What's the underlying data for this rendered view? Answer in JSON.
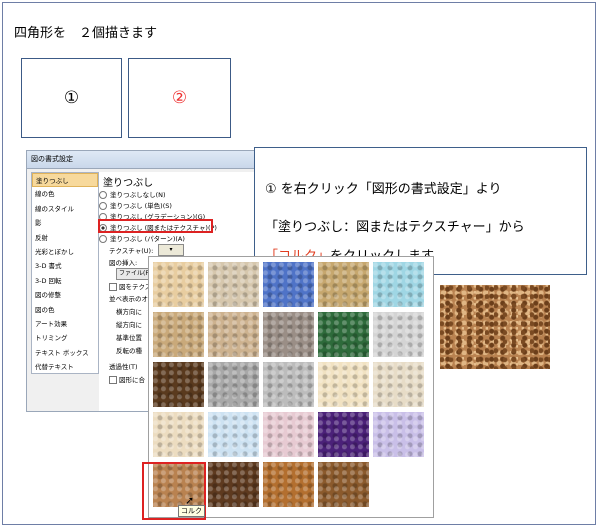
{
  "heading": "四角形を　２個描きます",
  "shapes": [
    {
      "label": "①",
      "color": "#000000"
    },
    {
      "label": "②",
      "color": "#e33333"
    }
  ],
  "dialog": {
    "title": "図の書式設定",
    "categories": [
      "塗りつぶし",
      "線の色",
      "線のスタイル",
      "影",
      "反射",
      "光彩とぼかし",
      "3-D 書式",
      "3-D 回転",
      "図の修整",
      "図の色",
      "アート効果",
      "トリミング",
      "テキスト ボックス",
      "代替テキスト"
    ],
    "selected_category": "塗りつぶし",
    "panel_heading": "塗りつぶし",
    "fill_options": [
      "塗りつぶしなし(N)",
      "塗りつぶし (単色)(S)",
      "塗りつぶし (グラデーション)(G)",
      "塗りつぶし (図またはテクスチャ)(P)",
      "塗りつぶし (パターン)(A)"
    ],
    "selected_fill_option": "塗りつぶし (図またはテクスチャ)(P)",
    "texture_label": "テクスチャ(U):",
    "insert_label": "図の挿入:",
    "file_button": "ファイル(F)",
    "tile_check": "図をテクス",
    "tile_options_label": "並べ表示のオ",
    "offset_x_label": "横方向に",
    "offset_y_label": "縦方向に",
    "align_label": "基準位置",
    "mirror_label": "反転の種",
    "transparency_label": "透過性(T)",
    "rotate_check": "図形に合"
  },
  "callout": {
    "line1": "① を右クリック「図形の書式設定」より",
    "line2": "「塗りつぶし：図またはテクスチャー」から",
    "line3_red": "「コルク」",
    "line3_rest": "をクリックします"
  },
  "palette": {
    "selected_tooltip": "コルク",
    "textures": [
      {
        "name": "texture-1",
        "color": "#e8cda0"
      },
      {
        "name": "texture-2",
        "color": "#d6c7ad"
      },
      {
        "name": "texture-3",
        "color": "#4f73c7"
      },
      {
        "name": "texture-4",
        "color": "#c6a76e"
      },
      {
        "name": "texture-5",
        "color": "#9fd6e4"
      },
      {
        "name": "texture-6",
        "color": "#c9a97a"
      },
      {
        "name": "texture-7",
        "color": "#cdb28f"
      },
      {
        "name": "texture-8",
        "color": "#9a8e86"
      },
      {
        "name": "texture-9",
        "color": "#2e6b3b"
      },
      {
        "name": "texture-10",
        "color": "#d4d4d4"
      },
      {
        "name": "texture-11",
        "color": "#5a3a1e"
      },
      {
        "name": "texture-12",
        "color": "#a8a8a8"
      },
      {
        "name": "texture-13",
        "color": "#bcbcbc"
      },
      {
        "name": "texture-14",
        "color": "#f1e2c2"
      },
      {
        "name": "texture-15",
        "color": "#e7dcc7"
      },
      {
        "name": "texture-16",
        "color": "#ecdcc0"
      },
      {
        "name": "texture-17",
        "color": "#cde2f2"
      },
      {
        "name": "texture-18",
        "color": "#e7cad2"
      },
      {
        "name": "texture-19",
        "color": "#4b2179"
      },
      {
        "name": "texture-20",
        "color": "#c9bfe8"
      },
      {
        "name": "cork",
        "color": "#b98250"
      },
      {
        "name": "texture-22",
        "color": "#5e3a1f"
      },
      {
        "name": "texture-23",
        "color": "#b36f2f"
      },
      {
        "name": "texture-24",
        "color": "#8b5a2c"
      }
    ]
  }
}
